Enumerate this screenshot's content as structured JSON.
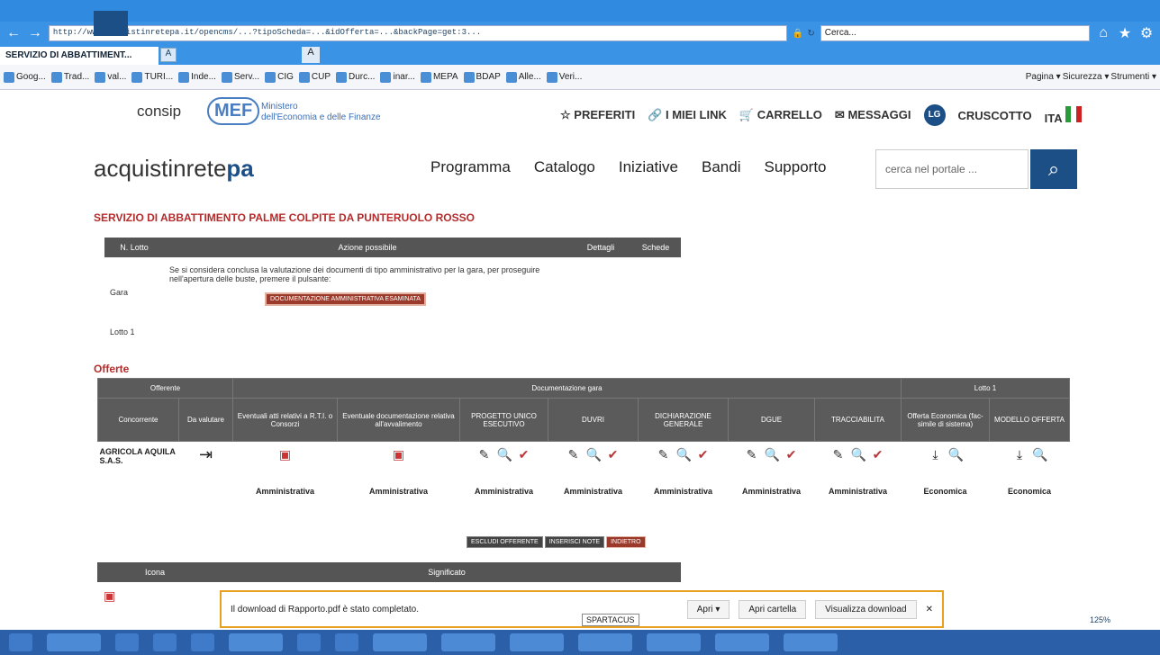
{
  "browser": {
    "address": "http://www.acquistinretepa.it/opencms/...?tipoScheda=...&idOfferta=...&backPage=get:3...",
    "search_placeholder": "Cerca...",
    "tab_title": "SERVIZIO DI ABBATTIMENT...",
    "favorites": [
      "Goog...",
      "Trad...",
      "val...",
      "TURI...",
      "Inde...",
      "Serv...",
      "CIG",
      "CUP",
      "Durc...",
      "inar...",
      "MEPA",
      "BDAP",
      "Alle...",
      "Veri..."
    ],
    "commands": [
      "Pagina ▾",
      "Sicurezza ▾",
      "Strumenti ▾"
    ]
  },
  "header": {
    "consip": "consip",
    "mef": "MEF",
    "mef_text_1": "Ministero",
    "mef_text_2": "dell'Economia e delle Finanze",
    "preferiti": "PREFERITI",
    "link": "I MIEI LINK",
    "carrello": "CARRELLO",
    "messaggi": "MESSAGGI",
    "avatar": "LG",
    "cruscotto": "CRUSCOTTO",
    "lang": "ITA"
  },
  "brand": {
    "a": "acquistinrete",
    "b": "pa"
  },
  "menu": [
    "Programma",
    "Catalogo",
    "Iniziative",
    "Bandi",
    "Supporto"
  ],
  "site_search_placeholder": "cerca nel portale ...",
  "page_title": "SERVIZIO DI ABBATTIMENTO PALME COLPITE DA PUNTERUOLO ROSSO",
  "lotti": {
    "cols": [
      "N. Lotto",
      "Azione possibile",
      "Dettagli",
      "Schede"
    ],
    "gara_label": "Gara",
    "gara_text": "Se si considera conclusa la valutazione dei documenti di tipo amministrativo per la gara, per proseguire nell'apertura delle buste, premere il pulsante:",
    "gara_button": "DOCUMENTAZIONE AMMINISTRATIVA ESAMINATA",
    "lotto_label": "Lotto 1"
  },
  "offerte": {
    "title": "Offerte",
    "group_offerente": "Offerente",
    "group_doc": "Documentazione gara",
    "group_lotto": "Lotto 1",
    "cols": [
      "Concorrente",
      "Da valutare",
      "Eventuali atti relativi a R.T.I. o Consorzi",
      "Eventuale documentazione relativa all'avvalimento",
      "PROGETTO UNICO ESECUTIVO",
      "DUVRI",
      "DICHIARAZIONE GENERALE",
      "DGUE",
      "TRACCIABILITA",
      "Offerta Economica (fac-simile di sistema)",
      "MODELLO OFFERTA"
    ],
    "row": {
      "concorrente": "AGRICOLA AQUILA S.A.S.",
      "labels": [
        "Amministrativa",
        "Amministrativa",
        "Amministrativa",
        "Amministrativa",
        "Amministrativa",
        "Amministrativa",
        "Amministrativa",
        "Economica",
        "Economica"
      ]
    }
  },
  "bottom_buttons": [
    "ESCLUDI OFFERENTE",
    "INSERISCI NOTE",
    "INDIETRO"
  ],
  "legend": {
    "cols": [
      "Icona",
      "Significato"
    ]
  },
  "download": {
    "message": "Il download di Rapporto.pdf è stato completato.",
    "open": "Apri",
    "open_folder": "Apri cartella",
    "view_downloads": "Visualizza download",
    "spartacus": "SPARTACUS",
    "zoom": "125%"
  }
}
